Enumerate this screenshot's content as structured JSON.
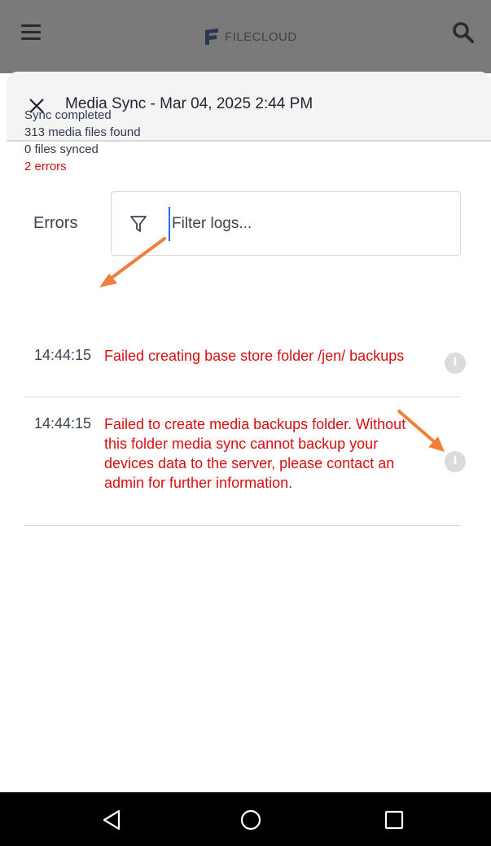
{
  "appbar": {
    "brand": "FILECLOUD",
    "menu_icon": "hamburger-icon",
    "search_icon": "search-icon"
  },
  "sheet": {
    "title": "Media Sync - Mar 04, 2025 2:44 PM",
    "close_icon": "close-icon"
  },
  "summary": {
    "status": "Sync completed",
    "found": "313 media files found",
    "synced": "0 files synced",
    "errors": "2 errors"
  },
  "filter": {
    "label": "Errors",
    "placeholder": "Filter logs...",
    "icon": "filter-icon"
  },
  "logs": [
    {
      "time": "14:44:15",
      "message": "Failed creating base store folder /jen/ backups"
    },
    {
      "time": "14:44:15",
      "message": "Failed to create media backups folder. Without this folder media sync cannot backup your devices data to the server, please contact an admin for further information."
    }
  ],
  "navbar": {
    "back_icon": "back-triangle-icon",
    "home_icon": "home-circle-icon",
    "recents_icon": "recents-square-icon"
  },
  "colors": {
    "appbar": "#7a7a7a",
    "error": "#d80f0f",
    "annotation_arrow": "#f07f3c"
  }
}
